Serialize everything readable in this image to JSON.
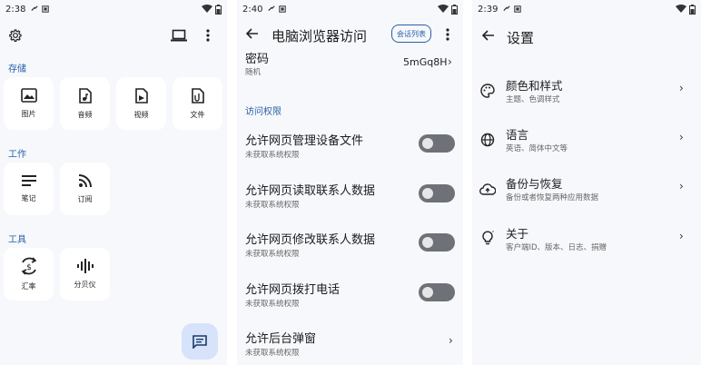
{
  "screen1": {
    "status": {
      "time": "2:38"
    },
    "sections": {
      "storage": "存储",
      "work": "工作",
      "tools": "工具"
    },
    "tiles": {
      "images": "图片",
      "audio": "音频",
      "video": "视频",
      "files": "文件",
      "notes": "笔记",
      "feeds": "订阅",
      "exchange": "汇率",
      "decibel": "分贝仪"
    }
  },
  "screen2": {
    "status": {
      "time": "2:40"
    },
    "title": "电脑浏览器访问",
    "chip": "会话列表",
    "password": {
      "title": "密码",
      "subtitle": "随机",
      "value": "5mGq8H"
    },
    "section": "访问权限",
    "rows": [
      {
        "title": "允许网页管理设备文件",
        "subtitle": "未获取系统权限"
      },
      {
        "title": "允许网页读取联系人数据",
        "subtitle": "未获取系统权限"
      },
      {
        "title": "允许网页修改联系人数据",
        "subtitle": "未获取系统权限"
      },
      {
        "title": "允许网页拨打电话",
        "subtitle": "未获取系统权限"
      },
      {
        "title": "允许后台弹窗",
        "subtitle": "未获取系统权限"
      }
    ]
  },
  "screen3": {
    "status": {
      "time": "2:39"
    },
    "title": "设置",
    "items": [
      {
        "title": "颜色和样式",
        "subtitle": "主题、色调样式",
        "icon": "palette-icon"
      },
      {
        "title": "语言",
        "subtitle": "英语、简体中文等",
        "icon": "globe-icon"
      },
      {
        "title": "备份与恢复",
        "subtitle": "备份或者恢复两种应用数据",
        "icon": "cloud-icon"
      },
      {
        "title": "关于",
        "subtitle": "客户端ID、版本、日志、捐赠",
        "icon": "bulb-icon"
      }
    ]
  },
  "colors": {
    "accent": "#2a60a8",
    "background": "#f6f8fb",
    "toggle_off": "#6e7178",
    "fab": "#d6e3fb"
  }
}
